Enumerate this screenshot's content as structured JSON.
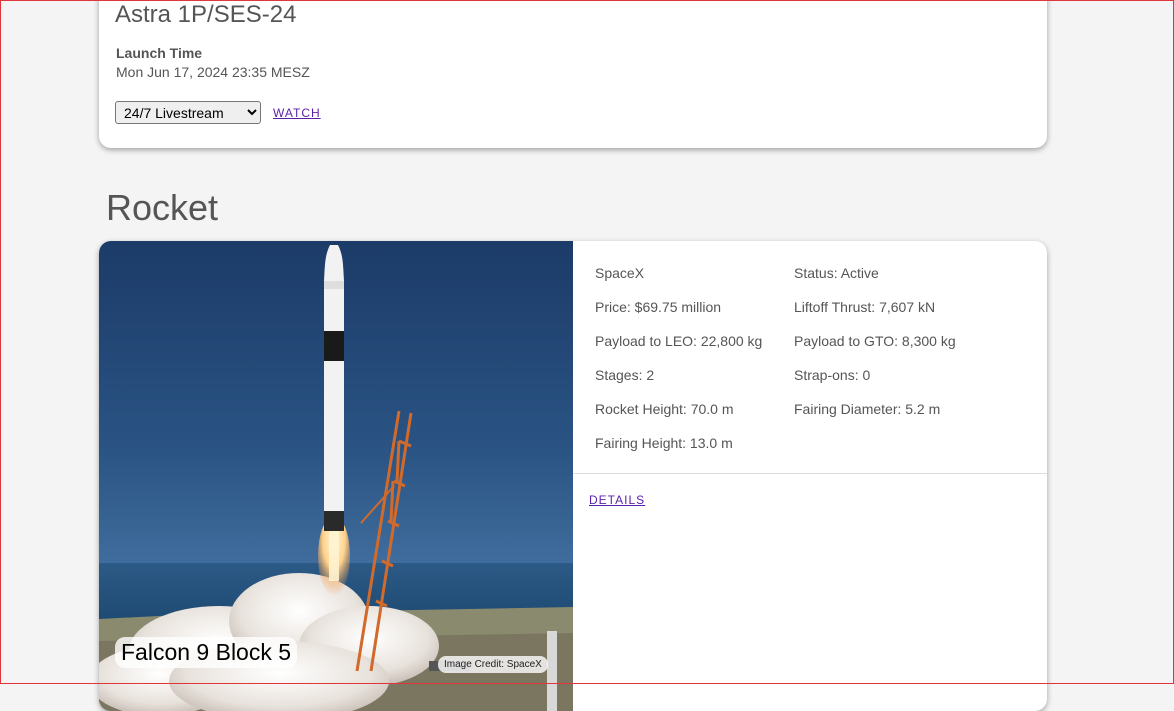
{
  "launch": {
    "title": "Astra 1P/SES-24",
    "time_label": "Launch Time",
    "time_value": "Mon Jun 17, 2024 23:35 MESZ",
    "stream_selected": "24/7 Livestream",
    "watch_label": "WATCH"
  },
  "rocket_section": {
    "title": "Rocket",
    "rocket_name": "Falcon 9 Block 5",
    "image_credit": "Image Credit: SpaceX",
    "specs": {
      "manufacturer": "SpaceX",
      "status": "Status: Active",
      "price": "Price: $69.75 million",
      "liftoff_thrust": "Liftoff Thrust: 7,607 kN",
      "payload_leo": "Payload to LEO: 22,800 kg",
      "payload_gto": "Payload to GTO: 8,300 kg",
      "stages": "Stages: 2",
      "strap_ons": "Strap-ons: 0",
      "rocket_height": "Rocket Height: 70.0 m",
      "fairing_diameter": "Fairing Diameter: 5.2 m",
      "fairing_height": "Fairing Height: 13.0 m"
    },
    "details_label": "DETAILS"
  },
  "colors": {
    "link": "#5a1fa8",
    "page_background": "#f4f4f4",
    "card_background": "#ffffff"
  }
}
